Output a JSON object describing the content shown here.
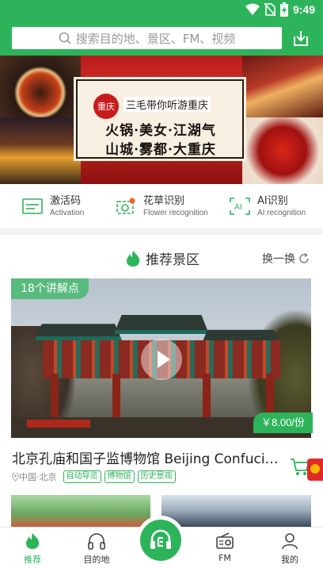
{
  "colors": {
    "brand_green": "#2db45a",
    "price_red": "#e02a2a"
  },
  "status_bar": {
    "time": "9:49",
    "icons": [
      "wifi-icon",
      "no-sim-icon",
      "battery-charging-icon"
    ]
  },
  "header": {
    "search_placeholder": "搜索目的地、景区、FM、视频",
    "search_icon": "search-icon",
    "download_icon": "download-icon"
  },
  "banner": {
    "tag": "重庆",
    "title": "三毛带你听游重庆",
    "line1": "火锅·美女·江湖气",
    "line2": "山城·雾都·大重庆"
  },
  "quick_links": [
    {
      "title": "激活码",
      "subtitle": "Activation",
      "icon": "activation-card-icon"
    },
    {
      "title": "花草识别",
      "subtitle": "Flower recognition",
      "icon": "flower-camera-icon"
    },
    {
      "title": "AI识别",
      "subtitle": "AI recognition",
      "icon": "ai-scan-icon"
    }
  ],
  "recommended": {
    "title": "推荐景区",
    "refresh_label": "换一换",
    "card": {
      "audio_count": "18个讲解点",
      "price": "￥8.00/份",
      "name": "北京孔庙和国子监博物馆 Beijing Confucius Temple",
      "location": "中国·北京",
      "tags": [
        "自动导览",
        "博物馆",
        "历史景观"
      ]
    }
  },
  "bottom_nav": {
    "items": [
      {
        "label": "推荐",
        "icon": "flame-icon",
        "active": true
      },
      {
        "label": "目的地",
        "icon": "headphones-icon",
        "active": false
      },
      {
        "label": "",
        "icon": "headset-guide-icon",
        "active": false
      },
      {
        "label": "FM",
        "icon": "radio-icon",
        "active": false
      },
      {
        "label": "我的",
        "icon": "profile-icon",
        "active": false
      }
    ]
  }
}
